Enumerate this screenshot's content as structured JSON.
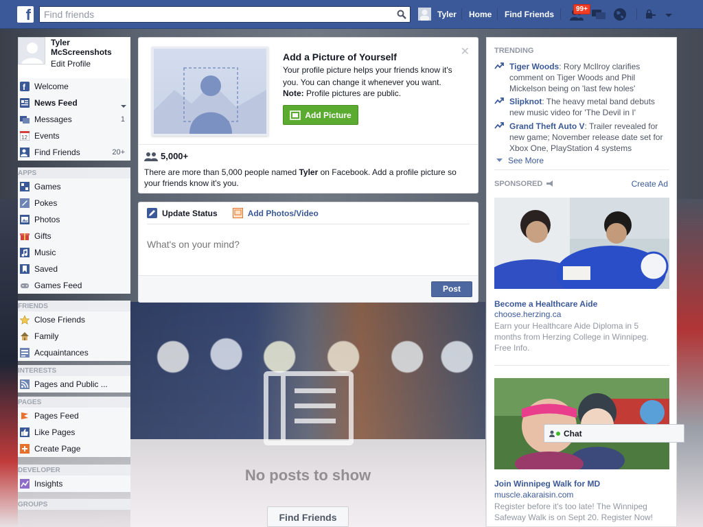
{
  "topbar": {
    "logo": "f",
    "search_placeholder": "Find friends",
    "user_name": "Tyler",
    "home": "Home",
    "find_friends": "Find Friends",
    "notifications_badge": "99+"
  },
  "profile": {
    "name": "Tyler McScreenshots",
    "edit": "Edit Profile"
  },
  "sidebar": {
    "favorites": [
      {
        "label": "Welcome",
        "icon": "welcome-icon",
        "count": ""
      },
      {
        "label": "News Feed",
        "icon": "news-feed-icon",
        "count": ""
      },
      {
        "label": "Messages",
        "icon": "messages-icon",
        "count": "1"
      },
      {
        "label": "Events",
        "icon": "calendar-icon",
        "count": ""
      },
      {
        "label": "Find Friends",
        "icon": "find-friends-icon",
        "count": "20+"
      }
    ],
    "apps_head": "APPS",
    "apps": [
      {
        "label": "Games",
        "icon": "games-icon"
      },
      {
        "label": "Pokes",
        "icon": "pokes-icon"
      },
      {
        "label": "Photos",
        "icon": "photos-icon"
      },
      {
        "label": "Gifts",
        "icon": "gifts-icon"
      },
      {
        "label": "Music",
        "icon": "music-icon"
      },
      {
        "label": "Saved",
        "icon": "saved-icon"
      },
      {
        "label": "Games Feed",
        "icon": "games-feed-icon"
      }
    ],
    "friends_head": "FRIENDS",
    "friends": [
      {
        "label": "Close Friends",
        "icon": "star-icon"
      },
      {
        "label": "Family",
        "icon": "house-icon"
      },
      {
        "label": "Acquaintances",
        "icon": "acquaintances-icon"
      }
    ],
    "interests_head": "INTERESTS",
    "interests": [
      {
        "label": "Pages and Public ...",
        "icon": "rss-icon"
      }
    ],
    "pages_head": "PAGES",
    "pages": [
      {
        "label": "Pages Feed",
        "icon": "pages-feed-icon"
      },
      {
        "label": "Like Pages",
        "icon": "thumbs-up-icon"
      },
      {
        "label": "Create Page",
        "icon": "create-page-icon"
      }
    ],
    "developer_head": "DEVELOPER",
    "developer": [
      {
        "label": "Insights",
        "icon": "insights-icon"
      }
    ],
    "groups_head": "GROUPS"
  },
  "profile_picture_card": {
    "title": "Add a Picture of Yourself",
    "desc": "Your profile picture helps your friends know it's you. You can change it whenever you want.",
    "note_label": "Note:",
    "note_text": "Profile pictures are public.",
    "button": "Add Picture",
    "count": "5,000+",
    "name_text_pre": "There are more than 5,000 people named ",
    "name_bold": "Tyler",
    "name_text_post": " on Facebook. Add a profile picture so your friends know it's you."
  },
  "composer": {
    "tab_status": "Update Status",
    "tab_photos": "Add Photos/Video",
    "placeholder": "What's on your mind?",
    "post": "Post"
  },
  "feed": {
    "empty": "No posts to show",
    "find_friends": "Find Friends"
  },
  "trending": {
    "head": "TRENDING",
    "items": [
      {
        "topic": "Tiger Woods",
        "text": ": Rory McIlroy clarifies comment on Tiger Woods and Phil Mickelson being on 'last few holes'"
      },
      {
        "topic": "Slipknot",
        "text": ": The heavy metal band debuts new music video for 'The Devil in I'"
      },
      {
        "topic": "Grand Theft Auto V",
        "text": ": Trailer revealed for new game; November release date set for Xbox One, PlayStation 4 systems"
      }
    ],
    "see_more": "See More"
  },
  "sponsored": {
    "head": "SPONSORED",
    "create_ad": "Create Ad",
    "ads": [
      {
        "title": "Become a Healthcare Aide",
        "url": "choose.herzing.ca",
        "body": "Earn your Healthcare Aide Diploma in 5 months from Herzing College in Winnipeg. Free Info."
      },
      {
        "title": "Join Winnipeg Walk for MD",
        "url": "muscle.akaraisin.com",
        "body": "Register before it's too late! The Winnipeg Safeway Walk is on Sept 20. Register Now!"
      }
    ]
  },
  "chat": {
    "label": "Chat"
  },
  "colors": {
    "brand": "#3b5998",
    "green": "#5bab30",
    "badge": "#f03d25"
  }
}
